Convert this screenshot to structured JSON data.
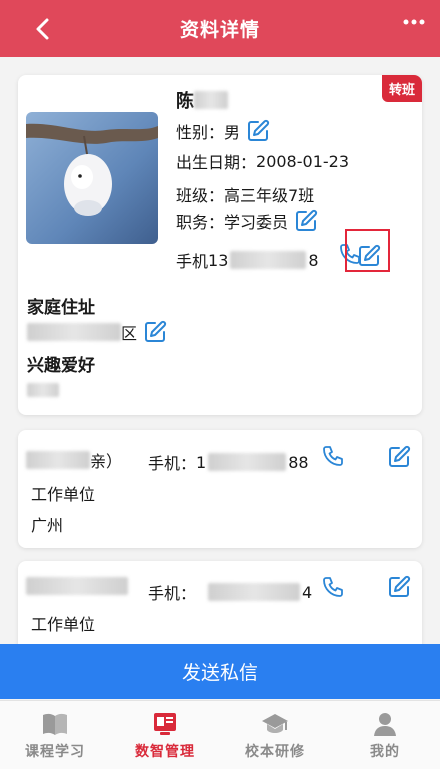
{
  "header": {
    "title": "资料详情"
  },
  "profile": {
    "transfer_badge": "转班",
    "name_visible": "陈",
    "gender_label": "性别：",
    "gender_value": "男",
    "birth_label": "出生日期：",
    "birth_value": "2008-01-23",
    "class_label": "班级：",
    "class_value": "高三年级7班",
    "duty_label": "职务：",
    "duty_value": "学习委员",
    "phone_label": "手机 ",
    "phone_prefix": "13",
    "phone_suffix": "8",
    "address_title": "家庭住址",
    "address_visible": "区",
    "hobby_title": "兴趣爱好"
  },
  "contacts": [
    {
      "relation_visible": "亲）",
      "phone_label": "手机：",
      "phone_prefix": "1",
      "phone_suffix": "88",
      "work_label": "工作单位",
      "work_value": "广州"
    },
    {
      "phone_label": "手机：",
      "phone_suffix": "4",
      "work_label": "工作单位"
    }
  ],
  "send_button": "发送私信",
  "tabs": [
    {
      "label": "课程学习",
      "icon": "book-icon",
      "active": false
    },
    {
      "label": "数智管理",
      "icon": "management-icon",
      "active": true
    },
    {
      "label": "校本研修",
      "icon": "graduation-cap-icon",
      "active": false
    },
    {
      "label": "我的",
      "icon": "user-icon",
      "active": false
    }
  ],
  "colors": {
    "header": "#e0485a",
    "badge": "#d92a3a",
    "accent_icon": "#2b86d6",
    "send_button": "#2a7ff0",
    "active_tab": "#d92a3a"
  }
}
